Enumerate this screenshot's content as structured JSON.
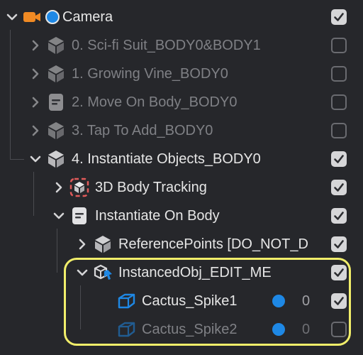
{
  "tree": {
    "items": [
      {
        "label": "Camera",
        "icon": "camera-icon",
        "expanded": true,
        "checked": true,
        "dim": false
      },
      {
        "label": "0. Sci-fi Suit_BODY0&BODY1",
        "icon": "object-icon",
        "expanded": false,
        "checked": false,
        "dim": true
      },
      {
        "label": "1. Growing Vine_BODY0",
        "icon": "object-icon",
        "expanded": false,
        "checked": false,
        "dim": true
      },
      {
        "label": "2. Move On Body_BODY0",
        "icon": "script-icon",
        "expanded": false,
        "checked": false,
        "dim": true
      },
      {
        "label": "3. Tap To Add_BODY0",
        "icon": "object-icon",
        "expanded": false,
        "checked": false,
        "dim": true
      },
      {
        "label": "4. Instantiate Objects_BODY0",
        "icon": "object-icon",
        "expanded": true,
        "checked": true,
        "dim": false
      },
      {
        "label": "3D Body Tracking",
        "icon": "body-tracking-icon",
        "expanded": false,
        "checked": true,
        "dim": false
      },
      {
        "label": "Instantiate On Body",
        "icon": "script-icon",
        "expanded": true,
        "checked": true,
        "dim": false
      },
      {
        "label": "ReferencePoints [DO_NOT_D",
        "icon": "object-icon",
        "expanded": false,
        "checked": true,
        "dim": false
      },
      {
        "label": "InstancedObj_EDIT_ME",
        "icon": "instance-object-icon",
        "expanded": true,
        "checked": true,
        "dim": false
      },
      {
        "label": "Cactus_Spike1",
        "icon": "mesh-cube-icon",
        "checked": true,
        "dim": false,
        "layer": "0"
      },
      {
        "label": "Cactus_Spike2",
        "icon": "mesh-cube-icon",
        "checked": false,
        "dim": true,
        "layer": "0"
      }
    ]
  },
  "colors": {
    "background": "#26272b",
    "highlight": "#f1ee6a",
    "accent_blue": "#1e88e5",
    "camera_orange": "#f08a24",
    "body_tracking_red": "#e05a5a",
    "checkbox_on": "#d6d6d8"
  }
}
